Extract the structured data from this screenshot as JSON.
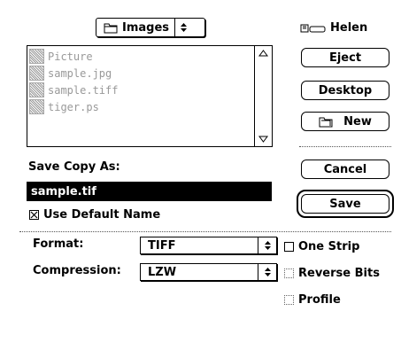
{
  "folder_popup": {
    "label": "Images",
    "icon": "folder-icon"
  },
  "volume": {
    "name": "Helen",
    "icon": "drive-icon"
  },
  "file_list": {
    "items": [
      {
        "name": "Picture",
        "icon": "document-icon"
      },
      {
        "name": "sample.jpg",
        "icon": "document-icon"
      },
      {
        "name": "sample.tiff",
        "icon": "document-icon"
      },
      {
        "name": "tiger.ps",
        "icon": "document-icon"
      }
    ]
  },
  "buttons": {
    "eject": "Eject",
    "desktop": "Desktop",
    "new": "New",
    "cancel": "Cancel",
    "save": "Save"
  },
  "save_as": {
    "label": "Save Copy As:",
    "value": "sample.tif"
  },
  "use_default_name": {
    "label": "Use Default Name",
    "checked": true
  },
  "format": {
    "label": "Format:",
    "value": "TIFF"
  },
  "compression": {
    "label": "Compression:",
    "value": "LZW"
  },
  "options": {
    "one_strip": {
      "label": "One Strip",
      "checked": false
    },
    "reverse_bits": {
      "label": "Reverse Bits",
      "checked": false
    },
    "profile": {
      "label": "Profile",
      "checked": false
    }
  }
}
